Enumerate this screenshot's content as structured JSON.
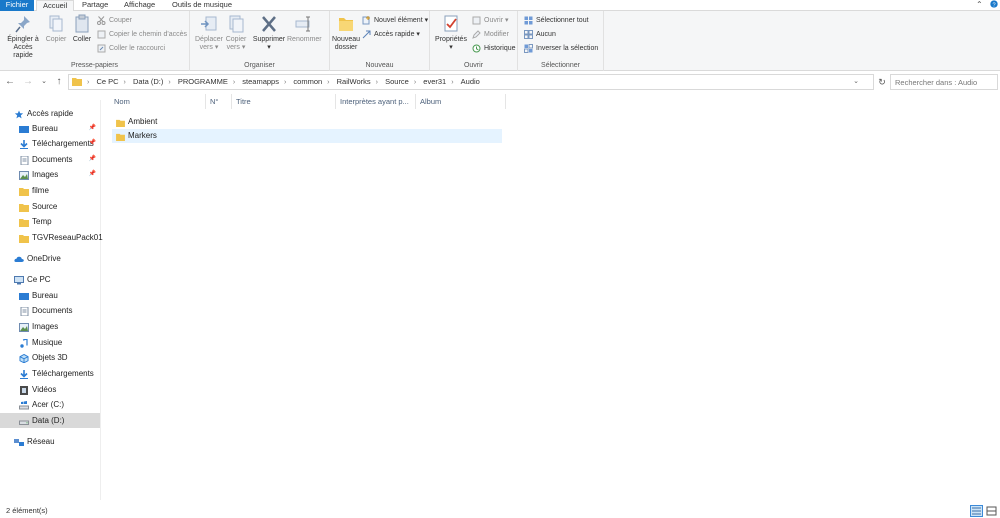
{
  "tabs": [
    "Fichier",
    "Accueil",
    "Partage",
    "Affichage",
    "Outils de musique"
  ],
  "ribbon": {
    "presse_papiers": {
      "label": "Presse-papiers",
      "pin_line1": "Épingler à",
      "pin_line2": "Accès rapide",
      "copy": "Copier",
      "paste": "Coller",
      "cut": "Couper",
      "copy_path": "Copier le chemin d'accès",
      "paste_shortcut": "Coller le raccourci"
    },
    "organiser": {
      "label": "Organiser",
      "move_line1": "Déplacer",
      "move_line2": "vers",
      "copyto_line1": "Copier",
      "copyto_line2": "vers",
      "delete": "Supprimer",
      "rename": "Renommer"
    },
    "nouveau": {
      "label": "Nouveau",
      "new_folder_line1": "Nouveau",
      "new_folder_line2": "dossier",
      "new_item": "Nouvel élément",
      "easy_access": "Accès rapide"
    },
    "ouvrir": {
      "label": "Ouvrir",
      "properties": "Propriétés",
      "open": "Ouvrir",
      "edit": "Modifier",
      "history": "Historique"
    },
    "selection": {
      "label": "Sélectionner",
      "select_all": "Sélectionner tout",
      "select_none": "Aucun",
      "invert": "Inverser la sélection"
    }
  },
  "address": {
    "crumbs": [
      "Ce PC",
      "Data (D:)",
      "PROGRAMME",
      "steamapps",
      "common",
      "RailWorks",
      "Source",
      "ever31",
      "Audio"
    ],
    "search_placeholder": "Rechercher dans : Audio"
  },
  "nav": {
    "quick_access": "Accès rapide",
    "quick_items": [
      "Bureau",
      "Téléchargements",
      "Documents",
      "Images",
      "filme",
      "Source",
      "Temp",
      "TGVReseauPack01"
    ],
    "onedrive": "OneDrive",
    "this_pc": "Ce PC",
    "pc_items": [
      "Bureau",
      "Documents",
      "Images",
      "Musique",
      "Objets 3D",
      "Téléchargements",
      "Vidéos",
      "Acer (C:)",
      "Data (D:)"
    ],
    "network": "Réseau"
  },
  "columns": [
    "Nom",
    "N°",
    "Titre",
    "Interprètes ayant p...",
    "Album"
  ],
  "files": [
    {
      "name": "Ambient"
    },
    {
      "name": "Markers"
    }
  ],
  "status": {
    "count": "2 élément(s)"
  },
  "colors": {
    "accent": "#1979ca",
    "folder": "#f0c34b",
    "hover_row": "#e5f3ff"
  }
}
